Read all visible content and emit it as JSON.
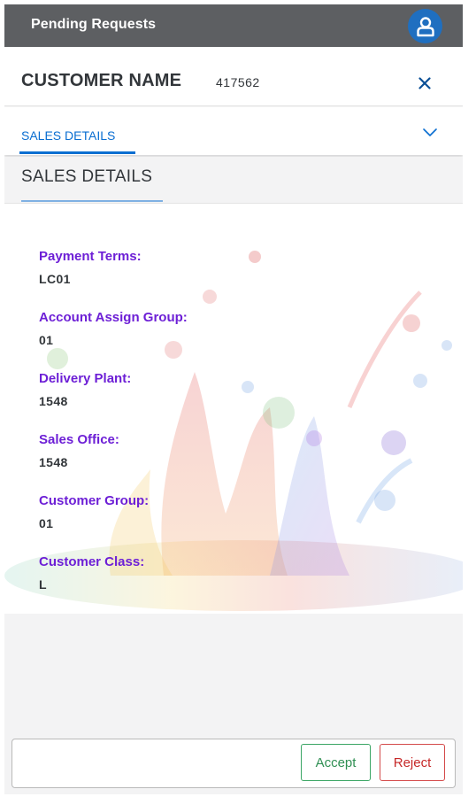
{
  "topbar": {
    "title": "Pending Requests",
    "avatar_icon": "user-icon",
    "color": "#5d5f62",
    "avatar_color": "#1f6fc0"
  },
  "header": {
    "customer_name": "CUSTOMER NAME",
    "customer_id": "417562",
    "close_icon": "close-icon"
  },
  "tabs": [
    {
      "label": "SALES DETAILS",
      "selected": true
    }
  ],
  "tab_expand_icon": "chevron-down-icon",
  "section": {
    "title": "SALES DETAILS"
  },
  "fields": [
    {
      "label": "Payment Terms:",
      "value": "LC01"
    },
    {
      "label": "Account Assign Group:",
      "value": "01"
    },
    {
      "label": "Delivery Plant:",
      "value": "1548"
    },
    {
      "label": "Sales Office:",
      "value": "1548"
    },
    {
      "label": "Customer Group:",
      "value": "01"
    },
    {
      "label": "Customer Class:",
      "value": "L"
    }
  ],
  "footer": {
    "accept_label": "Accept",
    "reject_label": "Reject"
  },
  "colors": {
    "accent": "#0a6ed1",
    "label": "#6d1fd6",
    "accept": "#2f8f53",
    "reject": "#c62828"
  }
}
